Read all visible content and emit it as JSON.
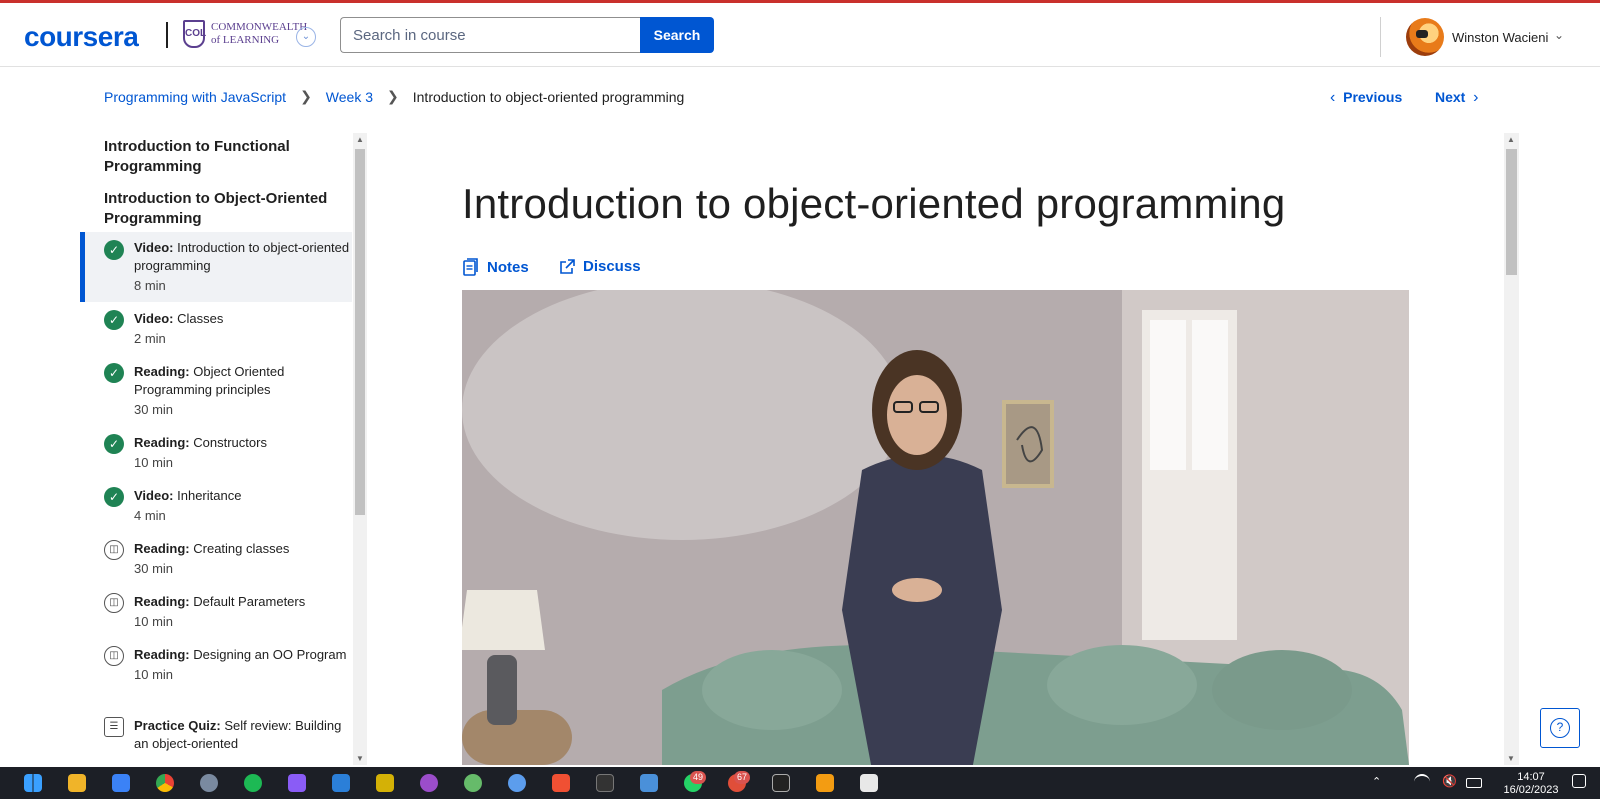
{
  "header": {
    "logo": "coursera",
    "partner_line1": "COMMONWEALTH",
    "partner_line2": "of LEARNING",
    "partner_crest": "COL",
    "search_placeholder": "Search in course",
    "search_button": "Search",
    "user_name": "Winston Wacieni"
  },
  "breadcrumb": {
    "course": "Programming with JavaScript",
    "week": "Week 3",
    "current": "Introduction to object-oriented programming"
  },
  "nav": {
    "previous": "Previous",
    "next": "Next"
  },
  "sidebar": {
    "sections": [
      "Introduction to Functional Programming",
      "Introduction to Object-Oriented Programming"
    ],
    "items": [
      {
        "kind": "Video:",
        "title": "Introduction to object-oriented programming",
        "duration": "8 min",
        "status": "done",
        "active": true
      },
      {
        "kind": "Video:",
        "title": "Classes",
        "duration": "2 min",
        "status": "done"
      },
      {
        "kind": "Reading:",
        "title": "Object Oriented Programming principles",
        "duration": "30 min",
        "status": "done"
      },
      {
        "kind": "Reading:",
        "title": "Constructors",
        "duration": "10 min",
        "status": "done"
      },
      {
        "kind": "Video:",
        "title": "Inheritance",
        "duration": "4 min",
        "status": "done"
      },
      {
        "kind": "Reading:",
        "title": "Creating classes",
        "duration": "30 min",
        "status": "reading"
      },
      {
        "kind": "Reading:",
        "title": "Default Parameters",
        "duration": "10 min",
        "status": "reading"
      },
      {
        "kind": "Reading:",
        "title": "Designing an OO Program",
        "duration": "10 min",
        "status": "reading"
      },
      {
        "kind": "Practice Quiz:",
        "title": "Self review: Building an object-oriented",
        "duration": "",
        "status": "quiz"
      }
    ]
  },
  "main": {
    "title": "Introduction to object-oriented programming",
    "notes": "Notes",
    "discuss": "Discuss"
  },
  "help_icon": "question-icon",
  "taskbar": {
    "badge_whatsapp": "49",
    "badge_other": "67",
    "time": "14:07",
    "date": "16/02/2023"
  },
  "colors": {
    "accent": "#0056d2",
    "done": "#1f8354",
    "taskbar": "#1c1f26"
  }
}
